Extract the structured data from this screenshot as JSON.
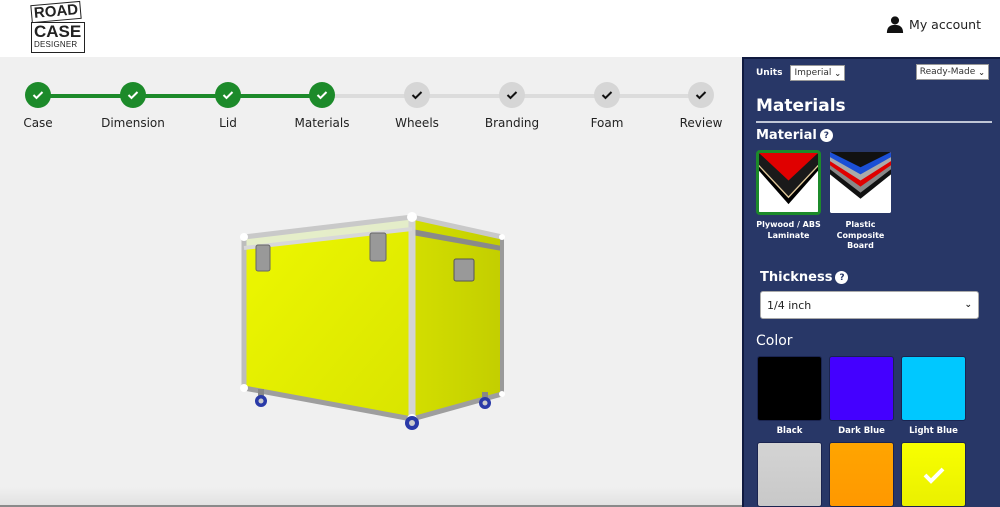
{
  "header": {
    "logo": {
      "line1": "ROAD",
      "line2": "CASE",
      "line3": "DESIGNER"
    },
    "account_label": "My account",
    "account_icon": "user-icon"
  },
  "stepper": {
    "complete_color": "#1c8a2a",
    "incomplete_color": "#d6d6d6",
    "steps": [
      {
        "label": "Case",
        "status": "complete"
      },
      {
        "label": "Dimension",
        "status": "complete"
      },
      {
        "label": "Lid",
        "status": "complete"
      },
      {
        "label": "Materials",
        "status": "complete"
      },
      {
        "label": "Wheels",
        "status": "incomplete"
      },
      {
        "label": "Branding",
        "status": "incomplete"
      },
      {
        "label": "Foam",
        "status": "incomplete"
      },
      {
        "label": "Review",
        "status": "incomplete"
      }
    ]
  },
  "preview": {
    "description": "3D road case preview",
    "case_color": "#e6f000"
  },
  "sidebar": {
    "units_label": "Units",
    "units_value": "Imperial",
    "mode_value": "Ready-Made",
    "panel_title": "Materials",
    "material_title": "Material",
    "help_glyph": "?",
    "materials": [
      {
        "label": "Plywood / ABS Laminate",
        "selected": true
      },
      {
        "label": "Plastic Composite Board",
        "selected": false
      }
    ],
    "thickness_title": "Thickness",
    "thickness_value": "1/4 inch",
    "color_title": "Color",
    "colors": [
      {
        "label": "Black",
        "hex": "#000000",
        "selected": false
      },
      {
        "label": "Dark Blue",
        "hex": "#4400ff",
        "selected": false
      },
      {
        "label": "Light Blue",
        "hex": "#00c8ff",
        "selected": false
      },
      {
        "label": "",
        "hex": "#d0d0d0",
        "selected": false
      },
      {
        "label": "",
        "hex": "#ffa200",
        "selected": false
      },
      {
        "label": "",
        "hex": "#f4ff00",
        "selected": true
      }
    ]
  }
}
